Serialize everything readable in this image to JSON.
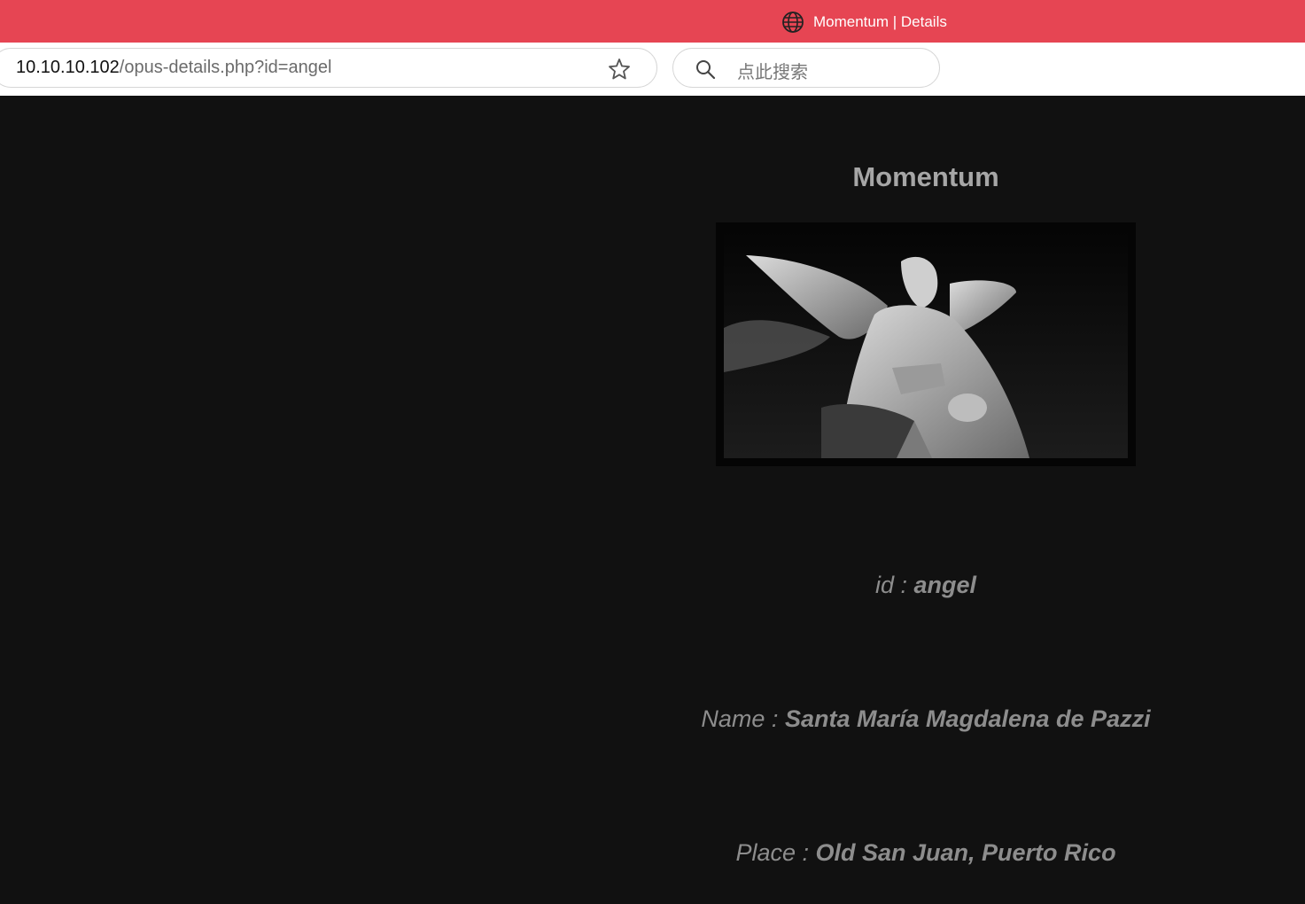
{
  "browser": {
    "tab_title": "Momentum | Details",
    "url_host": "10.10.10.102",
    "url_path": "/opus-details.php?id=angel",
    "search_placeholder": "点此搜索",
    "accent_color": "#e64553"
  },
  "page": {
    "title": "Momentum",
    "image_alt": "angel statue",
    "details": {
      "id_label": "id :",
      "id_value": "angel",
      "name_label": "Name :",
      "name_value": "Santa María Magdalena de Pazzi",
      "place_label": "Place :",
      "place_value": "Old San Juan, Puerto Rico"
    }
  }
}
